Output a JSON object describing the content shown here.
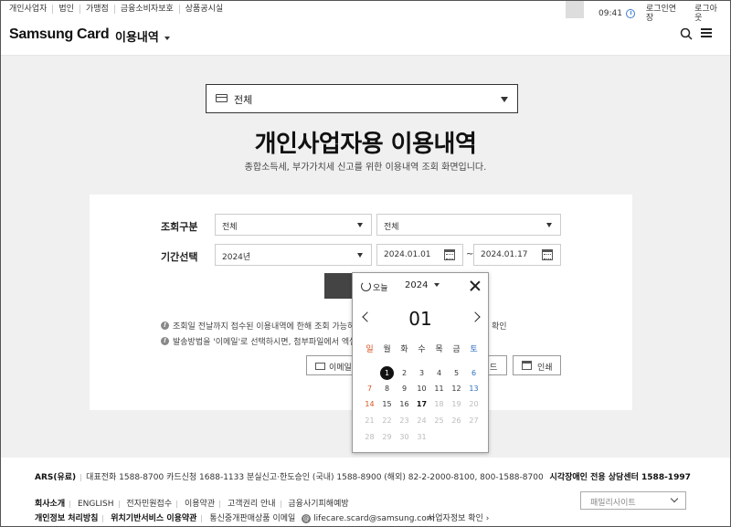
{
  "topbar": {
    "links": [
      "개인사업자",
      "법인",
      "가맹점",
      "금융소비자보호",
      "상품공시실"
    ],
    "time": "09:41",
    "extend_login": "로그인연장",
    "logout": "로그아웃"
  },
  "header": {
    "logo": "Samsung Card",
    "nav_title": "이용내역"
  },
  "category_select": {
    "value": "전체"
  },
  "page": {
    "title": "개인사업자용 이용내역",
    "subtitle": "종합소득세, 부가가치세 신고를 위한 이용내역 조회 화면입니다."
  },
  "form": {
    "inquiry_type_label": "조회구분",
    "inquiry_type_value_1": "전체",
    "inquiry_type_value_2": "전체",
    "period_label": "기간선택",
    "period_value": "2024년",
    "date_from": "2024.01.01",
    "date_to": "2024.01.17",
    "tilde": "~",
    "note_1": "조회일 전날까지 접수된 이용내역에 한해 조회 가능하",
    "note_1_tail": "확인",
    "note_2": "발송방법을 '이메일'로 선택하시면, 첨부파일에서 엑셀",
    "email_button": "이메일",
    "download_button": "드",
    "print_button": "인쇄"
  },
  "calendar": {
    "today_label": "오늘",
    "year": "2024",
    "month": "01",
    "weekdays": [
      "일",
      "월",
      "화",
      "수",
      "목",
      "금",
      "토"
    ],
    "weeks": [
      [
        "",
        "1",
        "2",
        "3",
        "4",
        "5",
        "6"
      ],
      [
        "7",
        "8",
        "9",
        "10",
        "11",
        "12",
        "13"
      ],
      [
        "14",
        "15",
        "16",
        "17",
        "18",
        "19",
        "20"
      ],
      [
        "21",
        "22",
        "23",
        "24",
        "25",
        "26",
        "27"
      ],
      [
        "28",
        "29",
        "30",
        "31",
        "",
        "",
        ""
      ]
    ],
    "selected_day": "1",
    "today_day": "17"
  },
  "footer": {
    "ars_label": "ARS(유료)",
    "phone_line": "대표전화 1588-8700  카드신청 1688-1133  분실신고·한도승인 (국내) 1588-8900 (해외) 82-2-2000-8100, 800-1588-8700",
    "accessibility": "시각장애인 전용 상담센터 1588-1997",
    "links_1": [
      "회사소개",
      "ENGLISH",
      "전자민원접수",
      "이용약관",
      "고객권리 안내",
      "금융사기피해예방"
    ],
    "links_2": [
      "개인정보 처리방침",
      "위치기반서비스 이용약관",
      "통신중개판매상품 이메일"
    ],
    "email": "lifecare.scard@samsung.com",
    "business_check": "사업자정보 확인",
    "family_site": "패밀리사이트"
  }
}
